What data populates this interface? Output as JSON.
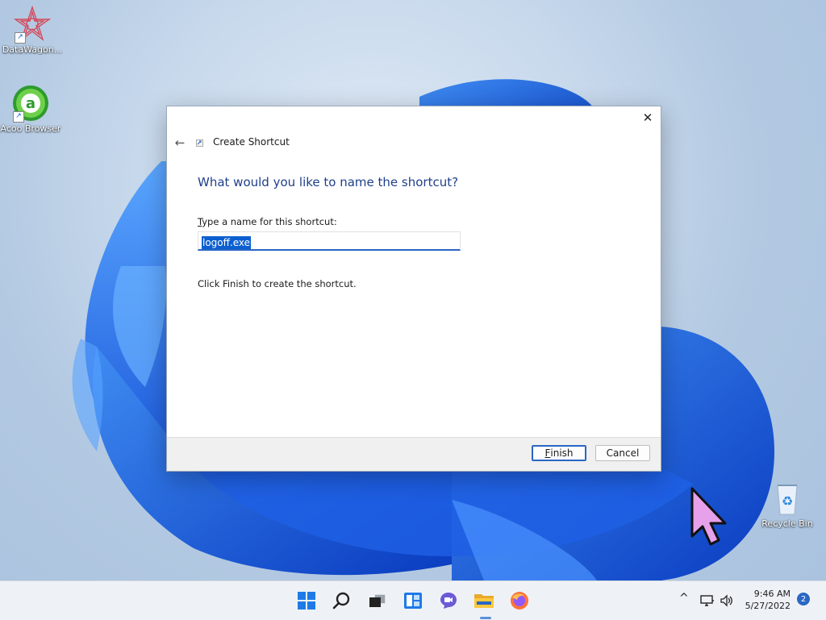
{
  "desktop": {
    "icons": [
      {
        "label": "DataWagon..."
      },
      {
        "label": "Acoo Browser"
      },
      {
        "label": "Recycle Bin"
      }
    ]
  },
  "dialog": {
    "title": "Create Shortcut",
    "heading": "What would you like to name the shortcut?",
    "field_label_key": "T",
    "field_label_rest": "ype a name for this shortcut:",
    "name_value": "logoff.exe",
    "hint": "Click Finish to create the shortcut.",
    "finish_key": "F",
    "finish_rest": "inish",
    "cancel_label": "Cancel",
    "close_glyph": "✕",
    "back_glyph": "←"
  },
  "taskbar": {
    "time": "9:46 AM",
    "date": "5/27/2022",
    "notification_count": "2",
    "chevron_glyph": "^",
    "apps": [
      "start-icon",
      "search-icon",
      "task-view-icon",
      "widgets-icon",
      "chat-icon",
      "file-explorer-icon",
      "firefox-icon"
    ]
  },
  "colors": {
    "accent": "#2a66c4",
    "heading": "#1f3f8a",
    "selection": "#0b5fd0",
    "cursor": "#e7a0ea"
  }
}
